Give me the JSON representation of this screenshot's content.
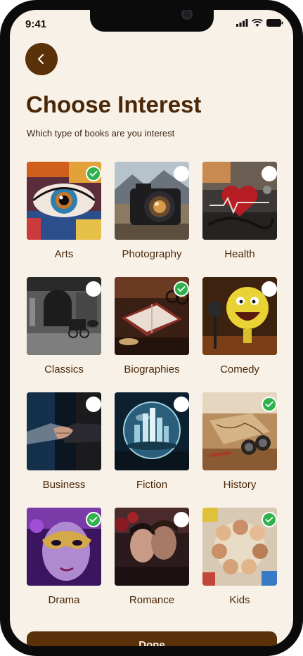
{
  "status": {
    "time": "9:41"
  },
  "header": {
    "title": "Choose Interest",
    "subtitle": "Which type of books are you interest"
  },
  "interests": [
    {
      "label": "Arts",
      "selected": true,
      "icon": "eye-art-image"
    },
    {
      "label": "Photography",
      "selected": false,
      "icon": "camera-image"
    },
    {
      "label": "Health",
      "selected": false,
      "icon": "stethoscope-heart-image"
    },
    {
      "label": "Classics",
      "selected": false,
      "icon": "horse-carriage-image"
    },
    {
      "label": "Biographies",
      "selected": true,
      "icon": "desk-book-image"
    },
    {
      "label": "Comedy",
      "selected": false,
      "icon": "laughing-character-image"
    },
    {
      "label": "Business",
      "selected": false,
      "icon": "handshake-image"
    },
    {
      "label": "Fiction",
      "selected": false,
      "icon": "glass-city-globe-image"
    },
    {
      "label": "History",
      "selected": true,
      "icon": "map-binoculars-image"
    },
    {
      "label": "Drama",
      "selected": true,
      "icon": "masquerade-mask-image"
    },
    {
      "label": "Romance",
      "selected": false,
      "icon": "couple-image"
    },
    {
      "label": "Kids",
      "selected": true,
      "icon": "children-circle-image"
    }
  ],
  "footer": {
    "done_label": "Done"
  },
  "colors": {
    "brand": "#5a3108",
    "background": "#f8f1e8",
    "check": "#2fb14c",
    "title": "#4a2707"
  }
}
